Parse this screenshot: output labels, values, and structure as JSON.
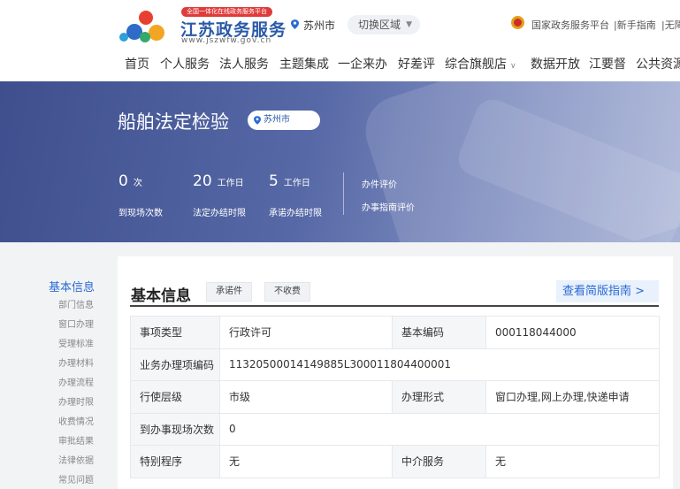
{
  "header": {
    "logo_badge": "全国一体化在线政务服务平台",
    "logo_title": "江苏政务服务",
    "logo_url": "www.jszwfw.gov.cn",
    "city": "苏州市",
    "switch_region": "切换区域",
    "top_links": [
      "国家政务服务平台",
      "|新手指南",
      "|无障"
    ],
    "nav": [
      "首页",
      "个人服务",
      "法人服务",
      "主题集成",
      "一企来办",
      "好差评",
      "综合旗舰店",
      "数据开放",
      "江要督",
      "公共资源"
    ]
  },
  "banner": {
    "title": "船舶法定检验",
    "city_tag": "苏州市",
    "stats": [
      {
        "num": "0",
        "unit": "次",
        "label": "到现场次数"
      },
      {
        "num": "20",
        "unit": "工作日",
        "label": "法定办结时限"
      },
      {
        "num": "5",
        "unit": "工作日",
        "label": "承诺办结时限"
      }
    ],
    "links": [
      "办件评价",
      "办事指南评价"
    ]
  },
  "sidebar": {
    "active": "基本信息",
    "items": [
      "部门信息",
      "窗口办理",
      "受理标准",
      "办理材料",
      "办理流程",
      "办理时限",
      "收费情况",
      "审批结果",
      "法律依据",
      "常见问题"
    ]
  },
  "main": {
    "section_title": "基本信息",
    "chips": [
      "承诺件",
      "不收费"
    ],
    "guide_button": "查看简版指南 >",
    "rows": [
      {
        "k1": "事项类型",
        "v1": "行政许可",
        "k2": "基本编码",
        "v2": "000118044000"
      },
      {
        "k1": "业务办理项编码",
        "v1": "11320500014149885L300011804400001"
      },
      {
        "k1": "行使层级",
        "v1": "市级",
        "k2": "办理形式",
        "v2": "窗口办理,网上办理,快递申请"
      },
      {
        "k1": "到办事现场次数",
        "v1": "0"
      },
      {
        "k1": "特别程序",
        "v1": "无",
        "k2": "中介服务",
        "v2": "无"
      }
    ]
  },
  "colors": {
    "brand_blue": "#2a5aa7",
    "link_blue": "#2a6ad4",
    "badge_red": "#e03b3b"
  },
  "icons": [
    "logo-icon",
    "location-pin-icon",
    "chevron-down-icon",
    "national-emblem-icon"
  ]
}
